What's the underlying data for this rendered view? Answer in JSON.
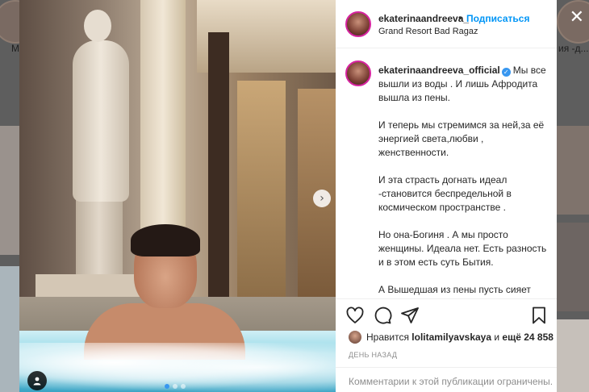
{
  "background": {
    "label_left": "М",
    "label_right": "ия -д..."
  },
  "header": {
    "username": "ekaterinaandreeva_",
    "separator": "•",
    "follow_label": "Подписаться",
    "location": "Grand Resort Bad Ragaz"
  },
  "caption": {
    "username": "ekaterinaandreeva_official",
    "paragraphs": [
      "Мы все вышли из воды . И лишь Афродита вышла из пены.",
      "И теперь мы стремимся за ней,за её энергией света,любви , женственности.",
      "И эта страсть догнать идеал -становится беспредельной в космическом пространстве .",
      "Но она-Богиня . А мы просто женщины. Идеала нет. Есть разность и в этом есть суть Бытия.",
      "А Вышедшая из пены пусть сияет нам своим мягким светом и даёт повод задуматься-идти ли вслед за её Звездой ,слега приближаясь,"
    ]
  },
  "likes": {
    "prefix": "Нравится",
    "user": "lolitamilyavskaya",
    "middle": "и",
    "count": "ещё 24 858"
  },
  "time_ago": "ДЕНЬ НАЗАД",
  "comments_disabled": "Комментарии к этой публикации ограничены.",
  "icons": {
    "like": "heart-icon",
    "comment": "comment-icon",
    "share": "send-icon",
    "save": "bookmark-icon",
    "next": "chevron-right-icon",
    "tagged": "user-tag-icon",
    "close": "close-icon"
  },
  "colors": {
    "link_blue": "#0095f6",
    "verified_blue": "#3897f0",
    "text": "#262626",
    "muted": "#8e8e8e"
  },
  "carousel": {
    "total": 3,
    "active_index": 0
  }
}
